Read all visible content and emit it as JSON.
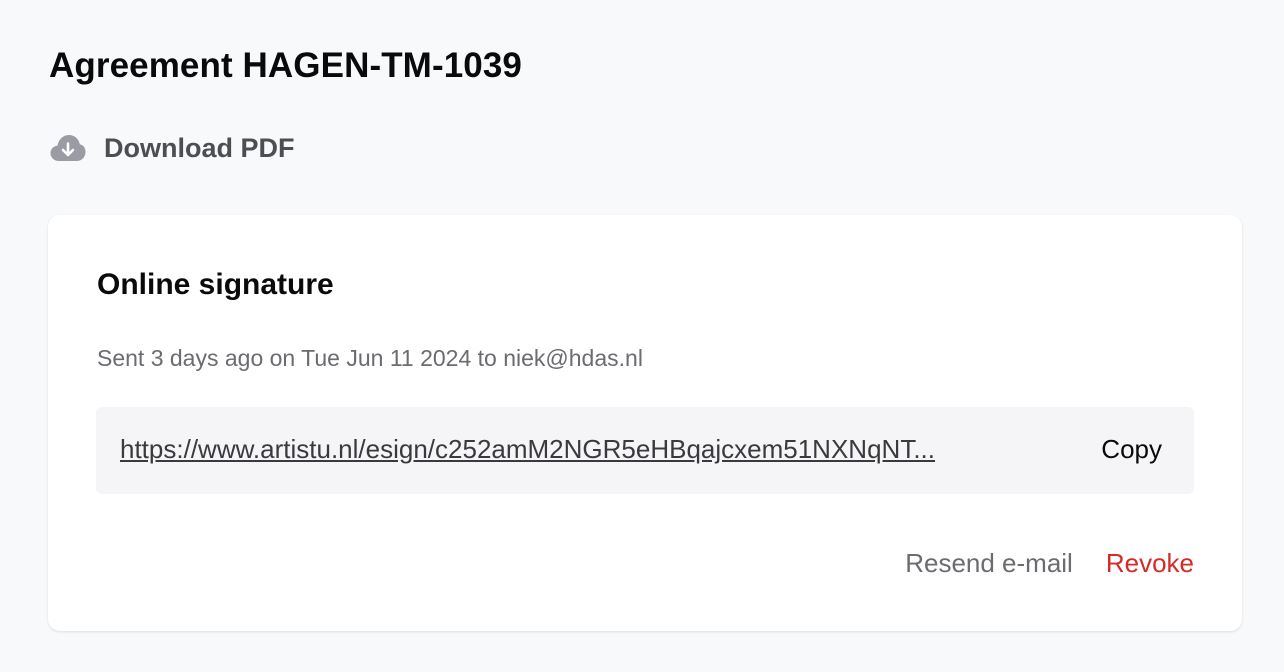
{
  "page": {
    "title": "Agreement HAGEN-TM-1039"
  },
  "download": {
    "icon": "cloud-download-icon",
    "label": "Download PDF"
  },
  "signature_card": {
    "title": "Online signature",
    "sent_info": "Sent 3 days ago on Tue Jun 11 2024 to niek@hdas.nl",
    "link_url": "https://www.artistu.nl/esign/c252amM2NGR5eHBqajcxem51NXNqNT...",
    "copy_label": "Copy",
    "resend_label": "Resend e-mail",
    "revoke_label": "Revoke"
  },
  "colors": {
    "background": "#f8f9fb",
    "card": "#ffffff",
    "link_box": "#f5f5f7",
    "muted_text": "#6b6b70",
    "danger": "#d42a2a",
    "icon": "#9b9ba3"
  }
}
